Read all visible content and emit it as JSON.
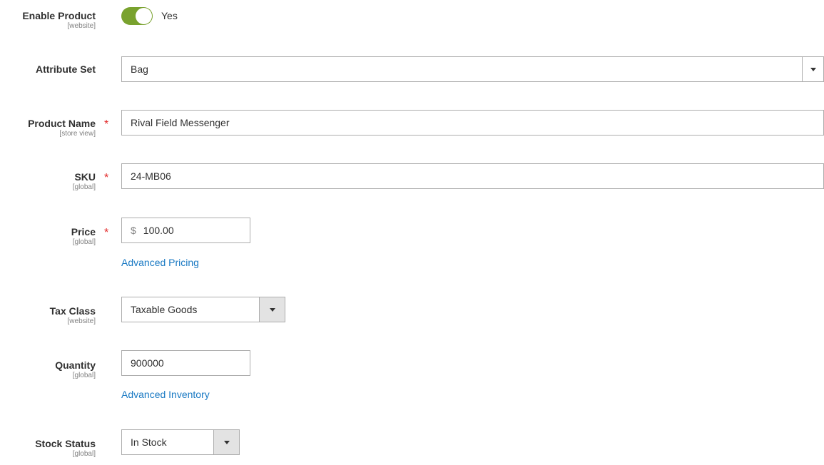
{
  "enable_product": {
    "label": "Enable Product",
    "scope": "[website]",
    "value": "Yes",
    "enabled": true,
    "toggle_color": "#79a22e"
  },
  "attribute_set": {
    "label": "Attribute Set",
    "value": "Bag"
  },
  "product_name": {
    "label": "Product Name",
    "scope": "[store view]",
    "required_mark": "*",
    "value": "Rival Field Messenger"
  },
  "sku": {
    "label": "SKU",
    "scope": "[global]",
    "required_mark": "*",
    "value": "24-MB06"
  },
  "price": {
    "label": "Price",
    "scope": "[global]",
    "required_mark": "*",
    "currency": "$",
    "value": "100.00",
    "advanced_link": "Advanced Pricing"
  },
  "tax_class": {
    "label": "Tax Class",
    "scope": "[website]",
    "value": "Taxable Goods"
  },
  "quantity": {
    "label": "Quantity",
    "scope": "[global]",
    "value": "900000",
    "advanced_link": "Advanced Inventory"
  },
  "stock_status": {
    "label": "Stock Status",
    "scope": "[global]",
    "value": "In Stock"
  },
  "colors": {
    "link": "#1979c3",
    "required": "#e22626",
    "toggle_on": "#79a22e"
  }
}
